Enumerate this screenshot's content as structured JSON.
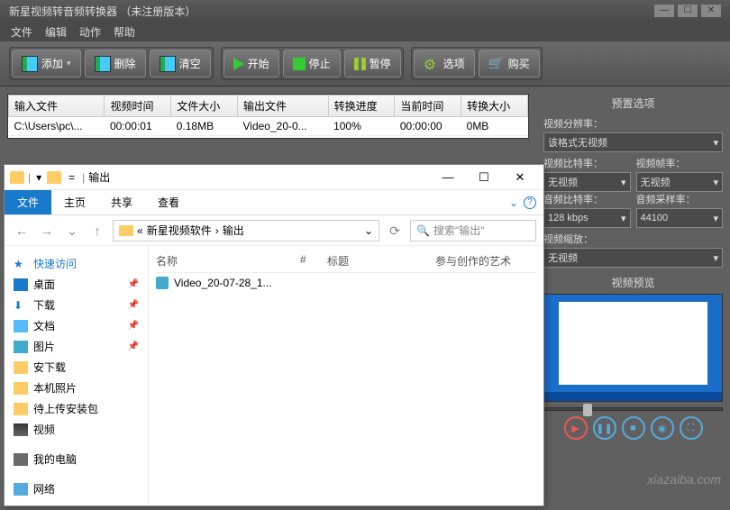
{
  "title": "新星视频转音频转换器  （未注册版本）",
  "menus": [
    "文件",
    "编辑",
    "动作",
    "帮助"
  ],
  "toolbar": {
    "add": "添加",
    "del": "删除",
    "clear": "清空",
    "start": "开始",
    "stop": "停止",
    "pause": "暂停",
    "options": "选项",
    "buy": "购买"
  },
  "table": {
    "headers": [
      "输入文件",
      "视频时间",
      "文件大小",
      "输出文件",
      "转换进度",
      "当前时间",
      "转换大小"
    ],
    "row": {
      "input": "C:\\Users\\pc\\...",
      "vtime": "00:00:01",
      "fsize": "0.18MB",
      "output": "Video_20-0...",
      "progress": "100%",
      "ctime": "00:00:00",
      "csize": "0MB"
    }
  },
  "preset": {
    "title": "预置选项",
    "res_label": "视频分辨率：",
    "res_value": "该格式无视频",
    "vbit_label": "视频比特率：",
    "vbit_value": "无视频",
    "vfps_label": "视频帧率：",
    "vfps_value": "无视频",
    "abit_label": "音频比特率：",
    "abit_value": "128 kbps",
    "asr_label": "音频采样率：",
    "asr_value": "44100",
    "zoom_label": "视频缩放：",
    "zoom_value": "无视频"
  },
  "preview_title": "视频预览",
  "explorer": {
    "qat_path": "输出",
    "tabs": [
      "文件",
      "主页",
      "共享",
      "查看"
    ],
    "breadcrumb": [
      "新星视频软件",
      "输出"
    ],
    "search_ph": "搜索\"输出\"",
    "side_quick": "快速访问",
    "side_items": [
      "桌面",
      "下载",
      "文档",
      "图片",
      "安下载",
      "本机照片",
      "待上传安装包",
      "视频"
    ],
    "side_pc": "我的电脑",
    "side_net": "网络",
    "cols": [
      "名称",
      "#",
      "标题",
      "参与创作的艺术"
    ],
    "file": "Video_20-07-28_1..."
  },
  "watermark": "xiazaiba.com"
}
